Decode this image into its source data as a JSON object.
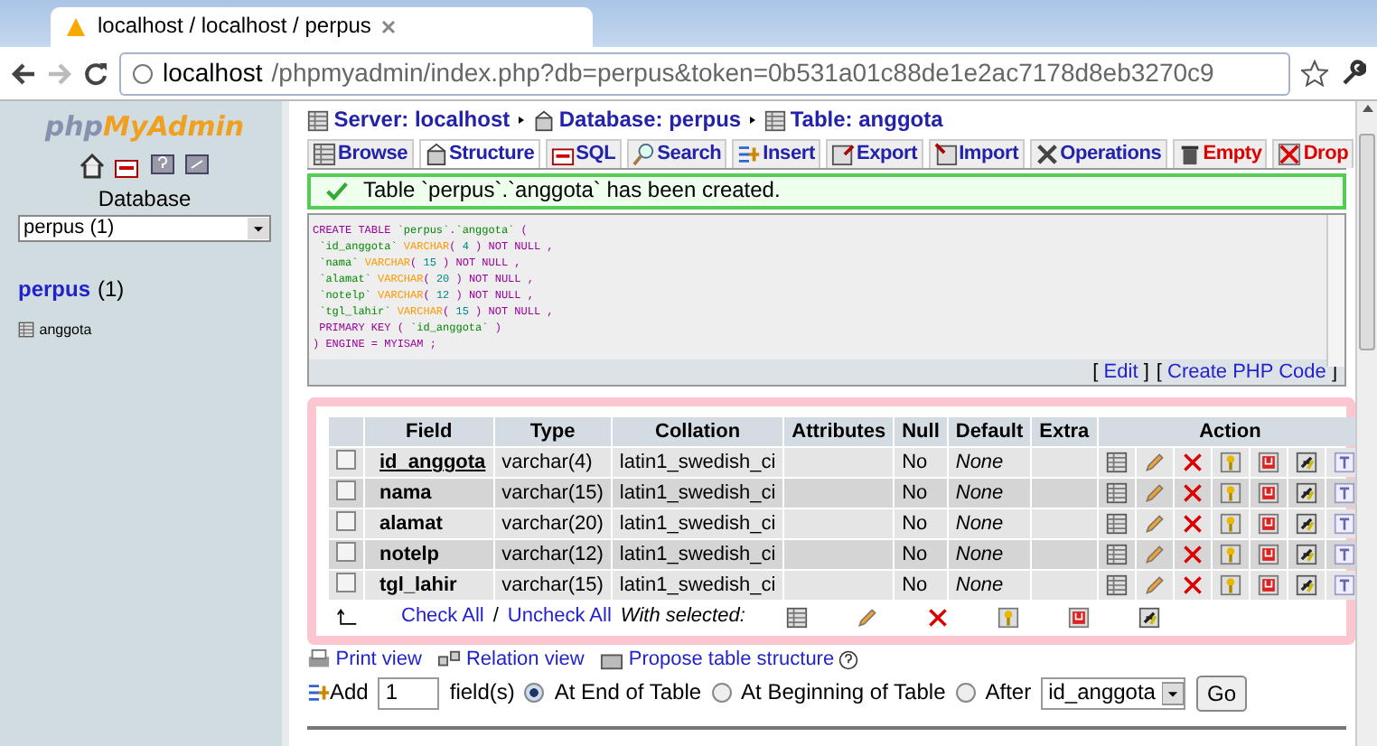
{
  "browser": {
    "tab_title": "localhost / localhost / perpus",
    "url_host": "localhost",
    "url_path": "/phpmyadmin/index.php?db=perpus&token=0b531a01c88de1e2ac7178d8eb3270c9"
  },
  "sidebar": {
    "logo_left": "php",
    "logo_right": "MyAdmin",
    "db_label": "Database",
    "db_select": "perpus (1)",
    "db_name": "perpus",
    "db_count": "(1)",
    "tables": [
      "anggota"
    ]
  },
  "breadcrumb": [
    "Server: localhost",
    "Database: perpus",
    "Table: anggota"
  ],
  "tabs": [
    {
      "label": "Browse",
      "kind": "normal",
      "selected": false
    },
    {
      "label": "Structure",
      "kind": "normal",
      "selected": true
    },
    {
      "label": "SQL",
      "kind": "normal",
      "selected": false
    },
    {
      "label": "Search",
      "kind": "normal",
      "selected": false
    },
    {
      "label": "Insert",
      "kind": "normal",
      "selected": false
    },
    {
      "label": "Export",
      "kind": "normal",
      "selected": false
    },
    {
      "label": "Import",
      "kind": "normal",
      "selected": false
    },
    {
      "label": "Operations",
      "kind": "normal",
      "selected": false
    },
    {
      "label": "Empty",
      "kind": "danger",
      "selected": false
    },
    {
      "label": "Drop",
      "kind": "danger",
      "selected": false
    }
  ],
  "message": "Table `perpus`.`anggota` has been created.",
  "sql_lines": [
    [
      {
        "text": "CREATE TABLE ",
        "kind": "keyword"
      },
      {
        "text": "`perpus`",
        "kind": "name"
      },
      {
        "text": ".",
        "kind": "punct"
      },
      {
        "text": "`anggota`",
        "kind": "name"
      },
      {
        "text": " (",
        "kind": "punct"
      }
    ],
    [
      {
        "text": " `id_anggota` ",
        "kind": "name"
      },
      {
        "text": "VARCHAR",
        "kind": "type"
      },
      {
        "text": "( ",
        "kind": "punct"
      },
      {
        "text": "4",
        "kind": "number"
      },
      {
        "text": " ) ",
        "kind": "punct"
      },
      {
        "text": "NOT NULL",
        "kind": "keyword"
      },
      {
        "text": " ,",
        "kind": "punct"
      }
    ],
    [
      {
        "text": " `nama` ",
        "kind": "name"
      },
      {
        "text": "VARCHAR",
        "kind": "type"
      },
      {
        "text": "( ",
        "kind": "punct"
      },
      {
        "text": "15",
        "kind": "number"
      },
      {
        "text": " ) ",
        "kind": "punct"
      },
      {
        "text": "NOT NULL",
        "kind": "keyword"
      },
      {
        "text": " ,",
        "kind": "punct"
      }
    ],
    [
      {
        "text": " `alamat` ",
        "kind": "name"
      },
      {
        "text": "VARCHAR",
        "kind": "type"
      },
      {
        "text": "( ",
        "kind": "punct"
      },
      {
        "text": "20",
        "kind": "number"
      },
      {
        "text": " ) ",
        "kind": "punct"
      },
      {
        "text": "NOT NULL",
        "kind": "keyword"
      },
      {
        "text": " ,",
        "kind": "punct"
      }
    ],
    [
      {
        "text": " `notelp` ",
        "kind": "name"
      },
      {
        "text": "VARCHAR",
        "kind": "type"
      },
      {
        "text": "( ",
        "kind": "punct"
      },
      {
        "text": "12",
        "kind": "number"
      },
      {
        "text": " ) ",
        "kind": "punct"
      },
      {
        "text": "NOT NULL",
        "kind": "keyword"
      },
      {
        "text": " ,",
        "kind": "punct"
      }
    ],
    [
      {
        "text": " `tgl_lahir` ",
        "kind": "name"
      },
      {
        "text": "VARCHAR",
        "kind": "type"
      },
      {
        "text": "( ",
        "kind": "punct"
      },
      {
        "text": "15",
        "kind": "number"
      },
      {
        "text": " ) ",
        "kind": "punct"
      },
      {
        "text": "NOT NULL",
        "kind": "keyword"
      },
      {
        "text": " ,",
        "kind": "punct"
      }
    ],
    [
      {
        "text": " PRIMARY KEY",
        "kind": "keyword"
      },
      {
        "text": " ( ",
        "kind": "punct"
      },
      {
        "text": "`id_anggota`",
        "kind": "name"
      },
      {
        "text": " )",
        "kind": "punct"
      }
    ],
    [
      {
        "text": ") ",
        "kind": "punct"
      },
      {
        "text": "ENGINE",
        "kind": "keyword"
      },
      {
        "text": " = ",
        "kind": "punct"
      },
      {
        "text": "MYISAM",
        "kind": "keyword"
      },
      {
        "text": " ;",
        "kind": "punct"
      }
    ]
  ],
  "sql_links": [
    {
      "open": "[",
      "label": "Edit",
      "close": "]"
    },
    {
      "open": "[",
      "label": "Create PHP Code",
      "close": "]"
    }
  ],
  "table": {
    "columns": [
      "Field",
      "Type",
      "Collation",
      "Attributes",
      "Null",
      "Default",
      "Extra",
      "Action"
    ],
    "rows": [
      {
        "field": "id_anggota",
        "primary": true,
        "type": "varchar(4)",
        "collation": "latin1_swedish_ci",
        "null": "No",
        "default": "None",
        "checked": false
      },
      {
        "field": "nama",
        "primary": false,
        "type": "varchar(15)",
        "collation": "latin1_swedish_ci",
        "null": "No",
        "default": "None",
        "checked": false
      },
      {
        "field": "alamat",
        "primary": false,
        "type": "varchar(20)",
        "collation": "latin1_swedish_ci",
        "null": "No",
        "default": "None",
        "checked": false
      },
      {
        "field": "notelp",
        "primary": false,
        "type": "varchar(12)",
        "collation": "latin1_swedish_ci",
        "null": "No",
        "default": "None",
        "checked": false
      },
      {
        "field": "tgl_lahir",
        "primary": false,
        "type": "varchar(15)",
        "collation": "latin1_swedish_ci",
        "null": "No",
        "default": "None",
        "checked": false
      }
    ]
  },
  "bulk": {
    "check_all": "Check All",
    "separator": "/",
    "uncheck_all": "Uncheck All",
    "with_selected": "With selected:"
  },
  "links": [
    "Print view",
    "Relation view",
    "Propose table structure"
  ],
  "add_field": {
    "label": "Add",
    "count": "1",
    "unit": "field(s)",
    "positions": [
      {
        "label": "At End of Table",
        "selected": true
      },
      {
        "label": "At Beginning of Table",
        "selected": false
      },
      {
        "label": "After",
        "selected": false
      }
    ],
    "after_field": "id_anggota",
    "go": "Go"
  }
}
